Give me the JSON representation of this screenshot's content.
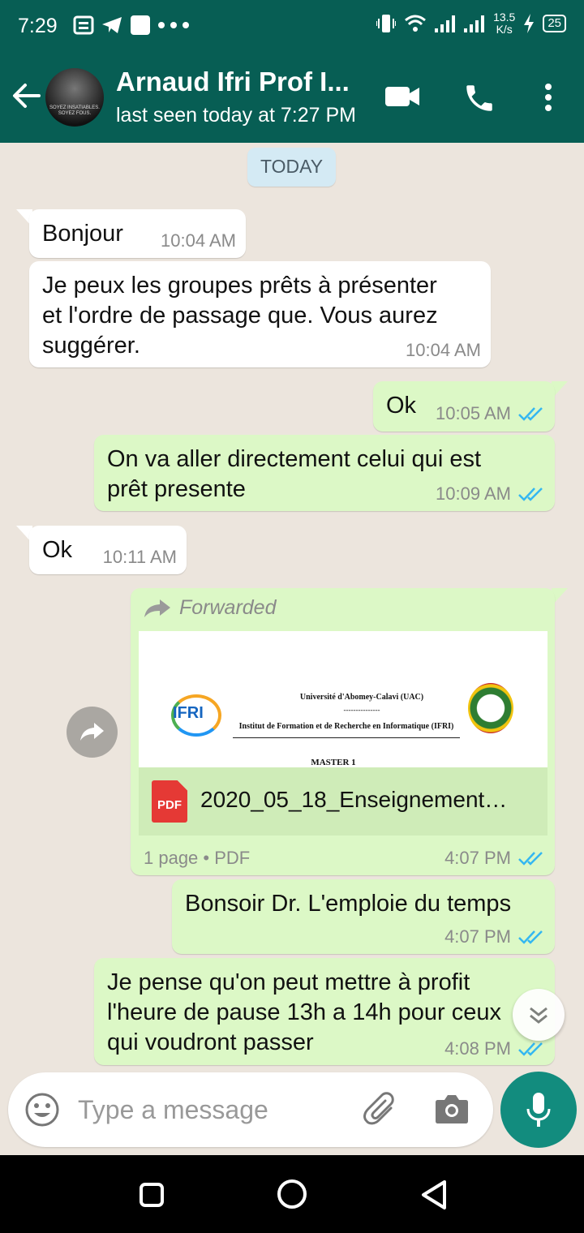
{
  "status_bar": {
    "time": "7:29",
    "net_speed_value": "13.5",
    "net_speed_unit": "K/s",
    "battery": "25"
  },
  "header": {
    "contact_name": "Arnaud Ifri Prof I...",
    "last_seen": "last seen today at 7:27 PM",
    "avatar_caption_1": "SOYEZ INSATIABLES.",
    "avatar_caption_2": "SOYEZ FOUS."
  },
  "chat": {
    "day_label": "TODAY",
    "messages": [
      {
        "direction": "in",
        "text": "Bonjour",
        "time": "10:04 AM"
      },
      {
        "direction": "in",
        "text_lines": [
          "Je peux les groupes prêts à présenter",
          "et l'ordre de passage que. Vous aurez",
          "suggérer."
        ],
        "time": "10:04 AM"
      },
      {
        "direction": "out",
        "text": "Ok",
        "time": "10:05 AM",
        "status": "read"
      },
      {
        "direction": "out",
        "text_lines": [
          "On va aller directement celui qui est",
          "prêt presente"
        ],
        "time": "10:09 AM",
        "status": "read"
      },
      {
        "direction": "in",
        "text": "Ok",
        "time": "10:11 AM"
      },
      {
        "direction": "out",
        "type": "document",
        "forwarded_label": "Forwarded",
        "preview": {
          "line1": "Université d'Abomey-Calavi (UAC)",
          "dashes": "---------------",
          "line2": "Institut de Formation et de Recherche en Informatique (IFRI)",
          "line3": "MASTER 1",
          "logo_text": "IFRI"
        },
        "file_icon_label": "PDF",
        "file_name": "2020_05_18_Enseignement…",
        "file_info": "1 page • PDF",
        "time": "4:07 PM",
        "status": "read"
      },
      {
        "direction": "out",
        "text": "Bonsoir Dr. L'emploie du temps",
        "time": "4:07 PM",
        "status": "read"
      },
      {
        "direction": "out",
        "text_lines": [
          "Je pense qu'on peut mettre à profit",
          "l'heure de pause 13h a 14h pour ceux",
          "qui voudront passer"
        ],
        "time": "4:08 PM",
        "status": "read"
      }
    ]
  },
  "composer": {
    "placeholder": "Type a message"
  },
  "colors": {
    "header": "#075e54",
    "outgoing_bubble": "#dcf8c6",
    "incoming_bubble": "#ffffff",
    "read_tick": "#34b7f1",
    "mic_button": "#128c7e",
    "chat_background": "#ece5dd"
  },
  "icons": [
    "back-arrow-icon",
    "video-call-icon",
    "phone-icon",
    "more-vert-icon",
    "forward-icon",
    "pdf-icon",
    "share-icon",
    "chevron-down-icon",
    "emoji-icon",
    "attach-icon",
    "camera-icon",
    "mic-icon"
  ]
}
